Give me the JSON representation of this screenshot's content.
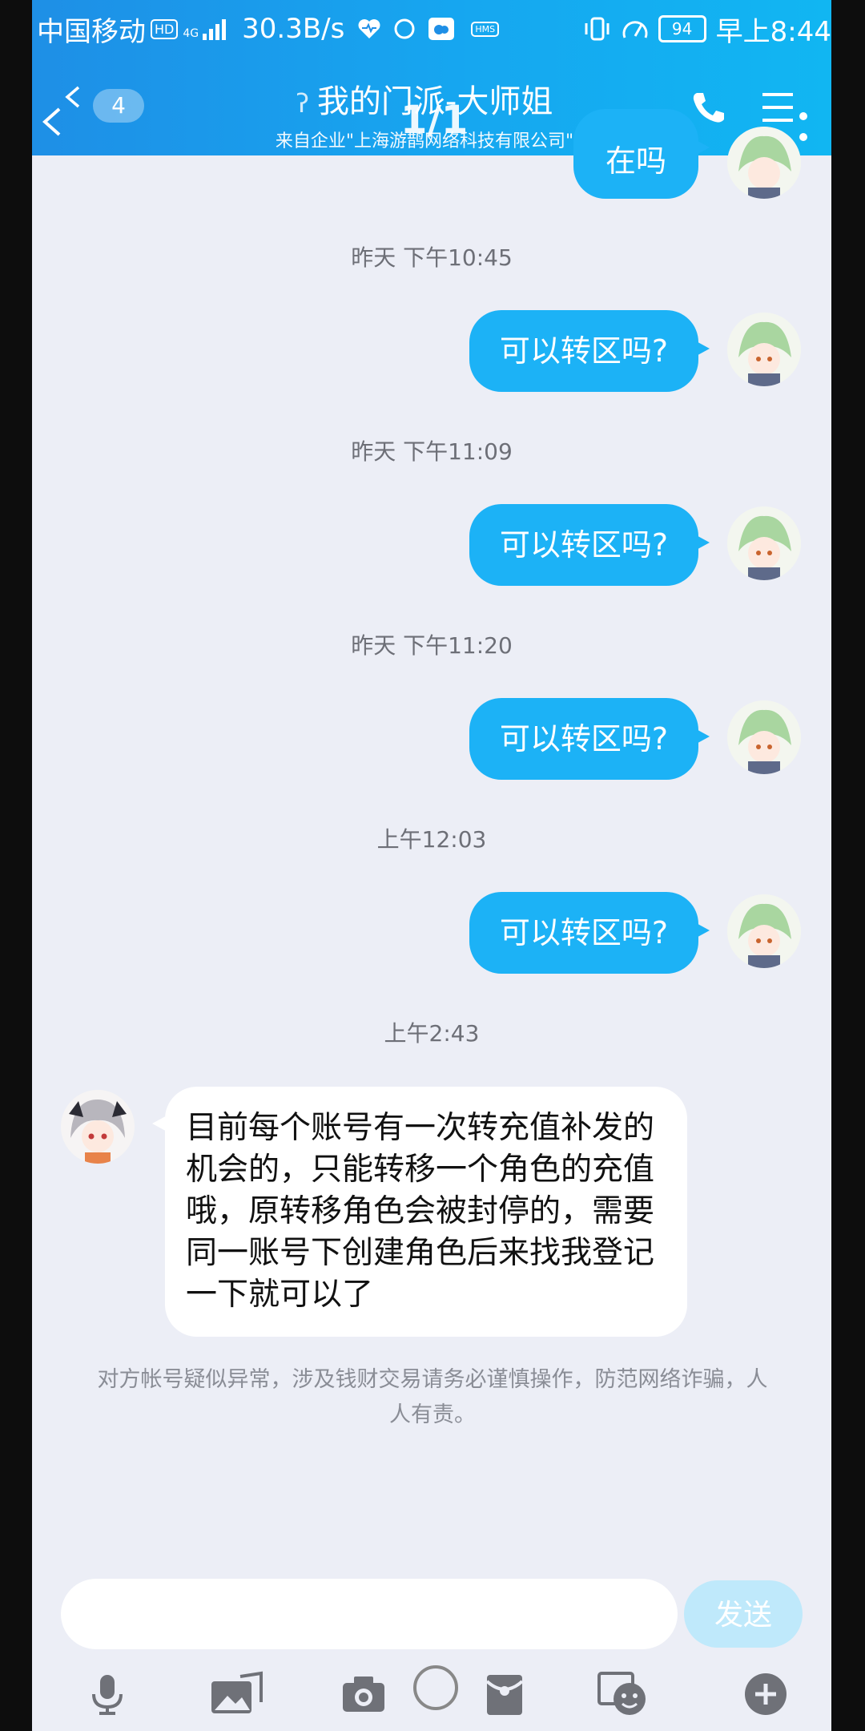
{
  "status_bar": {
    "carrier": "中国移动",
    "hd_tag": "HD",
    "network": "4G",
    "speed": "30.3B/s",
    "hms_tag": "HMS",
    "battery": "94",
    "time": "早上8:44"
  },
  "header": {
    "unread_count": "4",
    "title": "我的门派-大师姐",
    "subtitle": "来自企业\"上海游鹊网络科技有限公司\"",
    "page_counter": "1/1"
  },
  "top_bubble_partial": "在吗",
  "messages": [
    {
      "time": "昨天 下午10:45",
      "text": "可以转区吗?"
    },
    {
      "time": "昨天 下午11:09",
      "text": "可以转区吗?"
    },
    {
      "time": "昨天 下午11:20",
      "text": "可以转区吗?"
    },
    {
      "time": "上午12:03",
      "text": "可以转区吗?"
    }
  ],
  "reply": {
    "time": "上午2:43",
    "text": "目前每个账号有一次转充值补发的机会的，只能转移一个角色的充值哦，原转移角色会被封停的，需要同一账号下创建角色后来找我登记一下就可以了"
  },
  "warning": "对方帐号疑似异常，涉及钱财交易请务必谨慎操作，防范网络诈骗，人人有责。",
  "input": {
    "placeholder": "",
    "send_label": "发送"
  },
  "toolbar": [
    "mic-icon",
    "image-icon",
    "camera-icon",
    "redpacket-icon",
    "emoji-icon",
    "plus-icon"
  ],
  "colors": {
    "header_start": "#1e8fe6",
    "header_end": "#11b6f2",
    "bubble_out": "#1cb2f6",
    "send_disabled": "#bfe9fb"
  }
}
